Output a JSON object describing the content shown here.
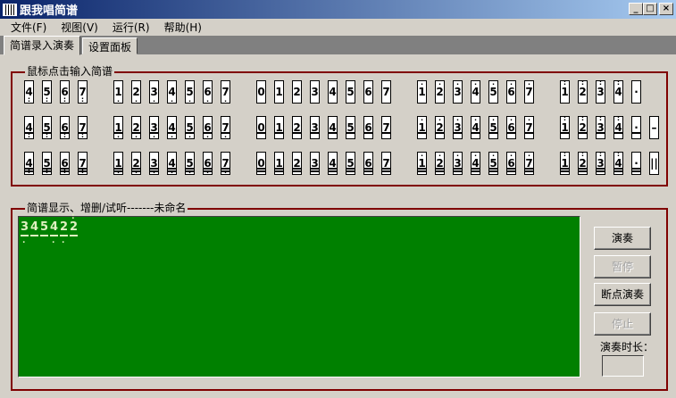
{
  "window": {
    "title": "跟我唱简谱",
    "min": "_",
    "max": "□",
    "close": "×"
  },
  "menu": [
    "文件(F)",
    "视图(V)",
    "运行(R)",
    "帮助(H)"
  ],
  "tabs": [
    "简谱录入演奏",
    "设置面板"
  ],
  "input_group": {
    "label": "鼠标点击输入简谱",
    "groups": [
      {
        "octave": "low-2",
        "digits": [
          "4",
          "5",
          "6",
          "7"
        ]
      },
      {
        "octave": "low-1",
        "digits": [
          "1",
          "2",
          "3",
          "4",
          "5",
          "6",
          "7"
        ]
      },
      {
        "octave": "middle",
        "digits": [
          "0",
          "1",
          "2",
          "3",
          "4",
          "5",
          "6",
          "7"
        ]
      },
      {
        "octave": "high-1",
        "digits": [
          "1",
          "2",
          "3",
          "4",
          "5",
          "6",
          "7"
        ]
      },
      {
        "octave": "high-2",
        "digits": [
          "1",
          "2",
          "3",
          "4"
        ]
      }
    ],
    "rows": [
      "quarter",
      "eighth",
      "sixteenth"
    ],
    "extras": [
      [
        "·"
      ],
      [
        "·",
        "–"
      ],
      [
        "·",
        "||"
      ]
    ]
  },
  "display_group": {
    "label": "简谱显示、增删/试听-------未命名",
    "notes": [
      {
        "d": "3",
        "dot": "below"
      },
      {
        "d": "4",
        "dot": ""
      },
      {
        "d": "5",
        "dot": ""
      },
      {
        "d": "4",
        "dot": "below"
      },
      {
        "d": "2",
        "dot": "below"
      },
      {
        "d": "2",
        "dot": "above2"
      }
    ]
  },
  "buttons": {
    "play": "演奏",
    "pause": "暂停",
    "breakpoint_play": "断点演奏",
    "stop": "停止"
  },
  "duration": {
    "label": "演奏时长：",
    "value": ""
  }
}
